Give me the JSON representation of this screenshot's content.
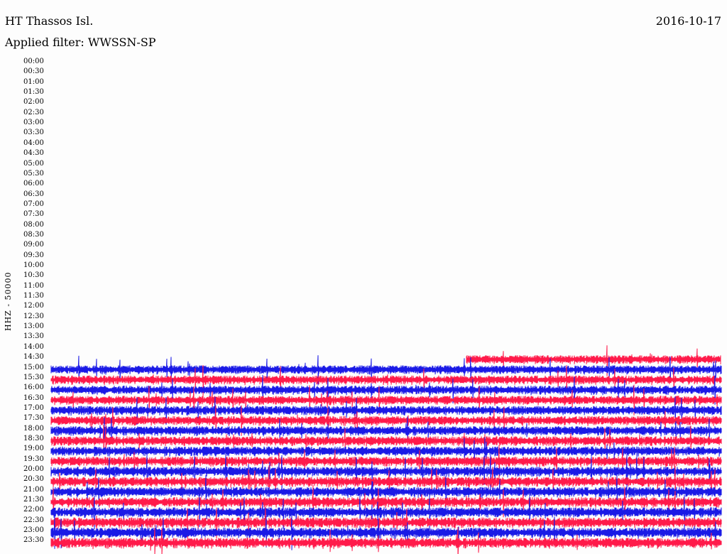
{
  "header": {
    "station": "HT Thassos Isl.",
    "date": "2016-10-17",
    "filter": "Applied filter: WWSSN-SP"
  },
  "y_axis_label": "HHZ - 50000",
  "chart_data": {
    "type": "line",
    "title": "HT Thassos Isl.",
    "subtitle": "Applied filter: WWSSN-SP",
    "date": "2016-10-17",
    "ylabel": "HHZ - 50000",
    "row_labels": [
      "00:00",
      "00:30",
      "01:00",
      "01:30",
      "02:00",
      "02:30",
      "03:00",
      "03:30",
      "04:00",
      "04:30",
      "05:00",
      "05:30",
      "06:00",
      "06:30",
      "07:00",
      "07:30",
      "08:00",
      "08:30",
      "09:00",
      "09:30",
      "10:00",
      "10:30",
      "11:00",
      "11:30",
      "12:00",
      "12:30",
      "13:00",
      "13:30",
      "14:00",
      "14:30",
      "15:00",
      "15:30",
      "16:00",
      "16:30",
      "17:00",
      "17:30",
      "18:00",
      "18:30",
      "19:00",
      "19:30",
      "20:00",
      "20:30",
      "21:00",
      "21:30",
      "22:00",
      "22:30",
      "23:00",
      "23:30"
    ],
    "series_colors": [
      "#1a1ae6",
      "#ff1a4a"
    ],
    "first_trace_row": "14:30",
    "partial_trace_row": "14:30",
    "partial_trace_start_fraction": 0.62
  }
}
